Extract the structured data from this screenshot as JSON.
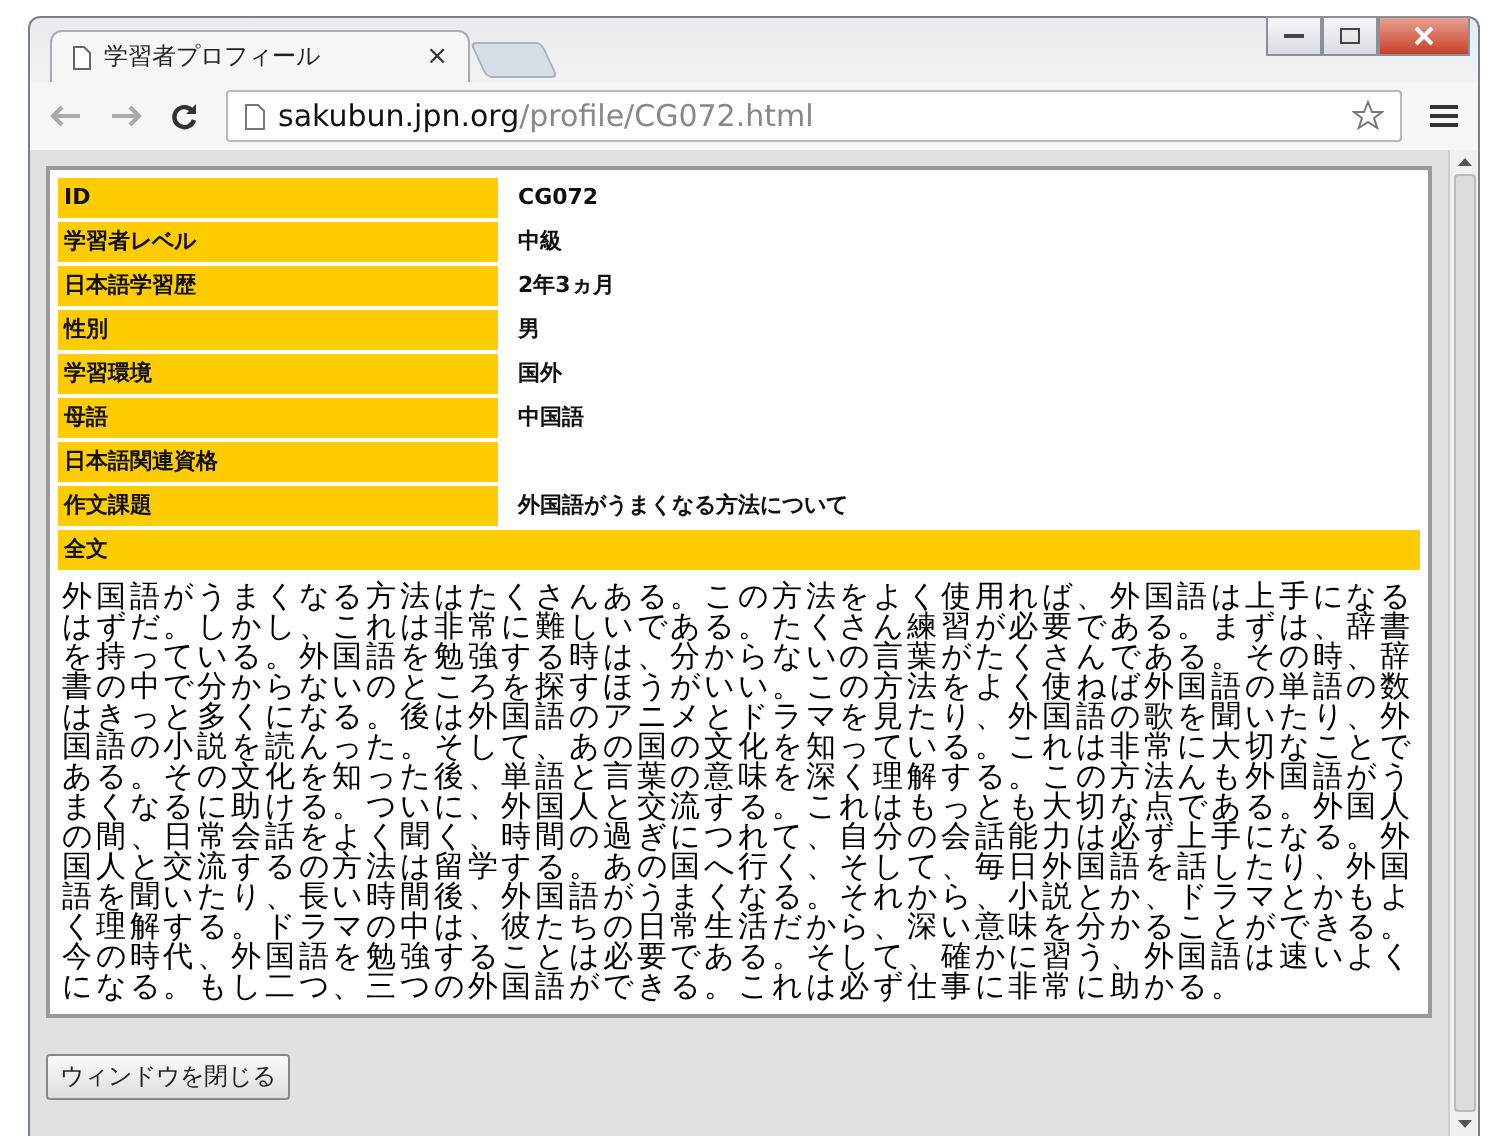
{
  "browser": {
    "tab_title": "学習者プロフィール",
    "tab_close": "×",
    "url_host": "sakubun.jpn.org",
    "url_path": "/profile/CG072.html"
  },
  "profile": {
    "rows": [
      {
        "label": "ID",
        "value": "CG072"
      },
      {
        "label": "学習者レベル",
        "value": "中級"
      },
      {
        "label": "日本語学習歴",
        "value": "2年3ヵ月"
      },
      {
        "label": "性別",
        "value": "男"
      },
      {
        "label": "学習環境",
        "value": "国外"
      },
      {
        "label": "母語",
        "value": "中国語"
      },
      {
        "label": "日本語関連資格"
      },
      {
        "label": "作文課題",
        "value": "外国語がうまくなる方法について"
      }
    ],
    "full_text_label": "全文",
    "essay": "外国語がうまくなる方法はたくさんある。この方法をよく使用れば、外国語は上手になるはずだ。しかし、これは非常に難しいである。たくさん練習が必要である。まずは、辞書を持っている。外国語を勉強する時は、分からないの言葉がたくさんである。その時、辞書の中で分からないのところを探すほうがいい。この方法をよく使ねば外国語の単語の数はきっと多くになる。後は外国語のアニメとドラマを見たり、外国語の歌を聞いたり、外国語の小説を読んった。そして、あの国の文化を知っている。これは非常に大切なことである。その文化を知った後、単語と言葉の意味を深く理解する。この方法んも外国語がうまくなるに助ける。ついに、外国人と交流する。これはもっとも大切な点である。外国人の間、日常会話をよく聞く、時間の過ぎにつれて、自分の会話能力は必ず上手になる。外国人と交流するの方法は留学する。あの国へ行く、そして、毎日外国語を話したり、外国語を聞いたり、長い時間後、外国語がうまくなる。それから、小説とか、ドラマとかもよく理解する。ドラマの中は、彼たちの日常生活だから、深い意味を分かることができる。今の時代、外国語を勉強することは必要である。そして、確かに習う、外国語は速いよくになる。もし二つ、三つの外国語ができる。これは必ず仕事に非常に助かる。"
  },
  "close_button": "ウィンドウを閉じる"
}
